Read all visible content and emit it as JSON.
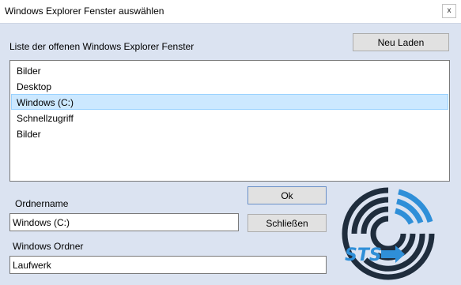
{
  "window": {
    "title": "Windows Explorer Fenster auswählen",
    "close_glyph": "x"
  },
  "list": {
    "label": "Liste der offenen Windows Explorer Fenster",
    "items": [
      "Bilder",
      "Desktop",
      "Windows (C:)",
      "Schnellzugriff",
      "Bilder"
    ],
    "selected_index": 2
  },
  "buttons": {
    "reload": "Neu Laden",
    "ok": "Ok",
    "close": "Schließen"
  },
  "fields": {
    "folder_name_label": "Ordnername",
    "folder_name_value": "Windows (C:)",
    "windows_folder_label": "Windows Ordner",
    "windows_folder_value": "Laufwerk"
  },
  "logo": {
    "text": "STS",
    "icon": "sts-maze-logo-icon",
    "colors": {
      "dark": "#1f2d3d",
      "accent": "#2f8fd8"
    }
  },
  "colors": {
    "background": "#dbe3f1",
    "selection": "#cce8ff"
  }
}
